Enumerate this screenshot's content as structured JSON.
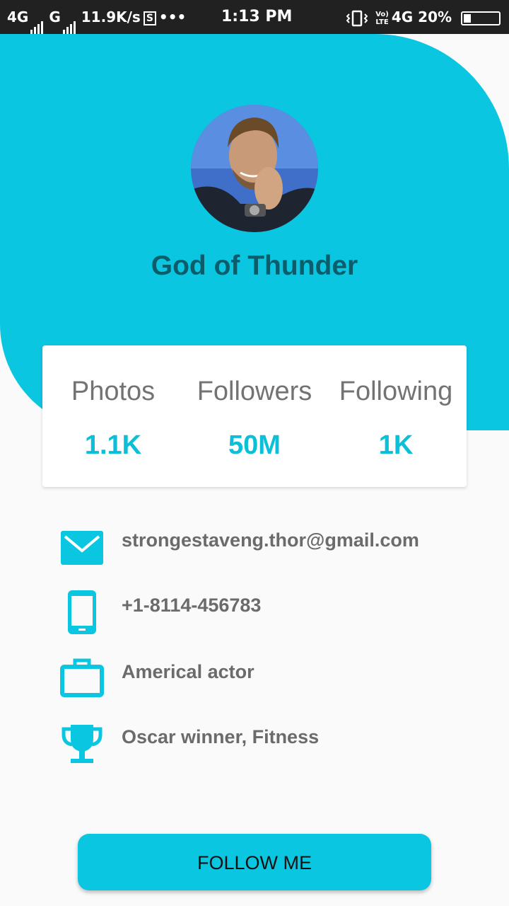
{
  "status_bar": {
    "network_1": "4G",
    "network_2": "G",
    "speed": "11.9K/s",
    "sim_icon_text": "S",
    "more": "•••",
    "time": "1:13 PM",
    "volte_top": "Vo)",
    "volte_bottom": "LTE",
    "network_3": "4G",
    "battery_percent": "20%",
    "battery_level": 0.2,
    "icons": [
      "signal-icon",
      "vibrate-icon",
      "battery-charging-icon"
    ]
  },
  "colors": {
    "accent": "#0bc6e0",
    "name_text": "#0b5d6b",
    "stat_value": "#0bbfd8",
    "muted_text": "#6b6b6b",
    "background": "#fafafa"
  },
  "profile": {
    "name": "God of Thunder",
    "avatar": "profile-photo"
  },
  "stats": [
    {
      "label": "Photos",
      "value": "1.1K"
    },
    {
      "label": "Followers",
      "value": "50M"
    },
    {
      "label": "Following",
      "value": "1K"
    }
  ],
  "info": [
    {
      "icon": "email-icon",
      "text": "strongestaveng.thor@gmail.com"
    },
    {
      "icon": "phone-icon",
      "text": "+1-8114-456783"
    },
    {
      "icon": "briefcase-icon",
      "text": "Americal actor"
    },
    {
      "icon": "trophy-icon",
      "text": "Oscar winner, Fitness"
    }
  ],
  "follow_button": {
    "label": "FOLLOW ME"
  }
}
